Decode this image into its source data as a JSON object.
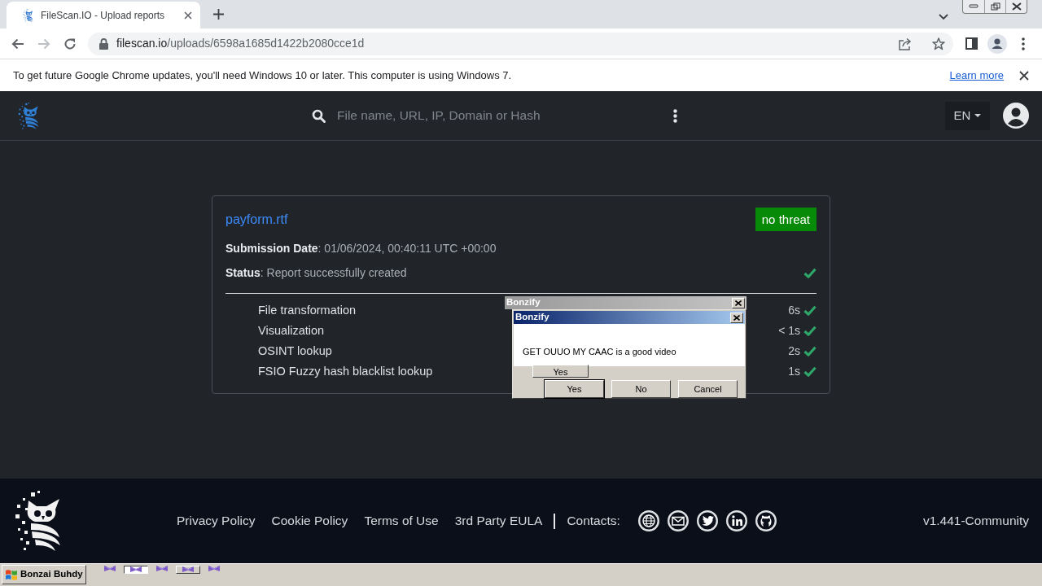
{
  "browser": {
    "tabs": [
      {
        "title": "FileScan.IO - Upload reports",
        "selected": true
      }
    ],
    "nav": {
      "back_disabled": false,
      "forward_disabled": true
    },
    "url_host": "filescan.io",
    "url_path": "/uploads/6598a1685d1422b2080cce1d"
  },
  "infobar": {
    "message": "To get future Google Chrome updates, you'll need Windows 10 or later. This computer is using Windows 7.",
    "link": "Learn more"
  },
  "site_header": {
    "search_placeholder": "File name, URL, IP, Domain or Hash",
    "language": "EN"
  },
  "report": {
    "file_name": "payform.rtf",
    "verdict": "no threat",
    "submission": "**Submission Date**: 01/06/2024, 00:40:11 UTC +00:00",
    "status": {
      "text": "**Status**: Report successfully created",
      "completed": true
    },
    "tasks": [
      {
        "name": "File transformation",
        "duration": "6s",
        "completed": true
      },
      {
        "name": "Visualization",
        "duration": "< 1s",
        "completed": true
      },
      {
        "name": "OSINT lookup",
        "duration": "2s",
        "completed": true
      },
      {
        "name": "FSIO Fuzzy hash blacklist lookup",
        "duration": "1s",
        "completed": true
      }
    ]
  },
  "dialogs": [
    {
      "title": "Bonzify",
      "active": false,
      "buttons": [
        {
          "label": "Yes",
          "default": false
        }
      ]
    },
    {
      "title": "Bonzify",
      "active": true,
      "message": "GET OUUO MY CAAC is a good video",
      "buttons": [
        {
          "label": "Yes",
          "default": true
        },
        {
          "label": "No",
          "default": false
        },
        {
          "label": "Cancel",
          "default": false
        }
      ]
    }
  ],
  "footer": {
    "links": [
      "Privacy Policy",
      "Cookie Policy",
      "Terms of Use",
      "3rd Party EULA"
    ],
    "contacts_label": "Contacts:",
    "version": "v1.441-Community"
  },
  "taskbar": {
    "start_label": "Bonzai Buhdy",
    "items": [
      {
        "kind": "icon",
        "selected": false
      },
      {
        "kind": "button",
        "selected": true
      },
      {
        "kind": "icon",
        "selected": false
      },
      {
        "kind": "button",
        "selected": false
      },
      {
        "kind": "icon",
        "selected": false
      }
    ]
  }
}
